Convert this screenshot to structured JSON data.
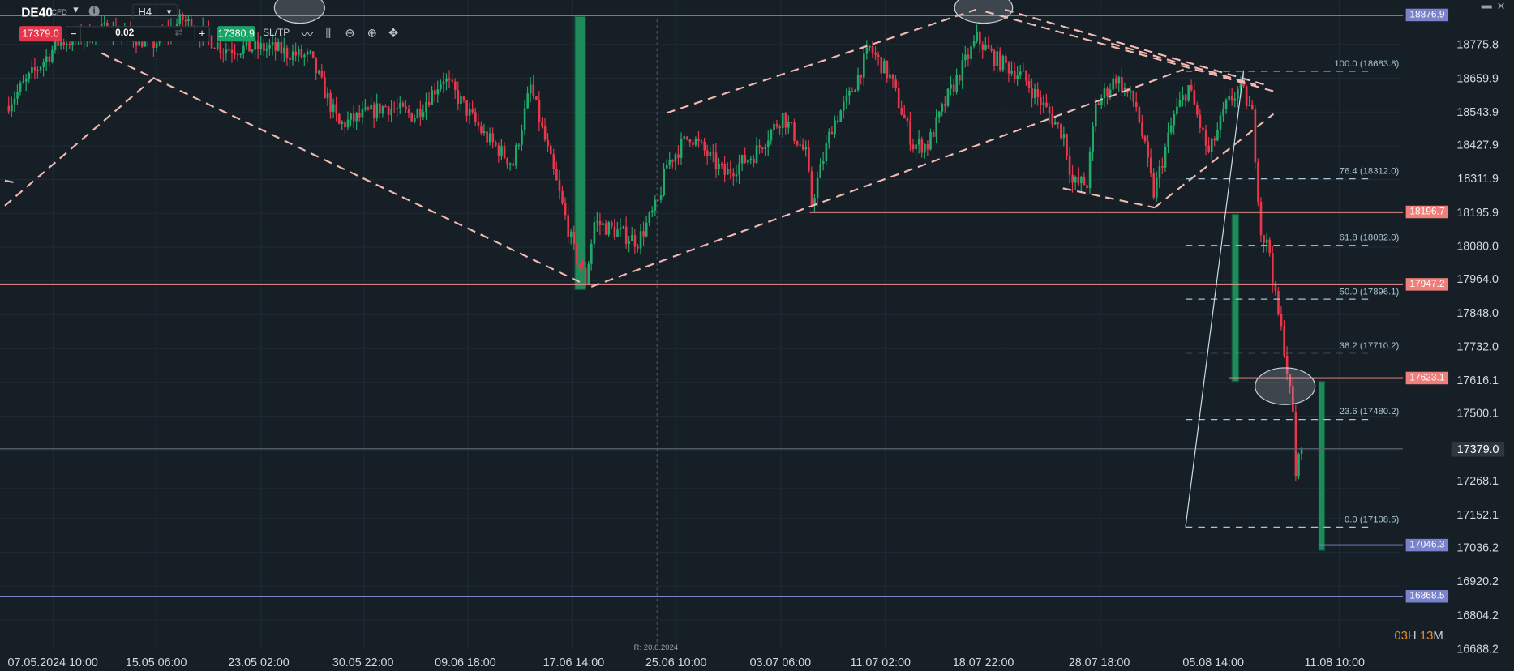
{
  "toolbar": {
    "symbol": "DE40",
    "symbol_type": "CFD",
    "timeframe": "H4",
    "sell_price": "17379.0",
    "buy_price": "17380.9",
    "volume": "0.02",
    "minus": "−",
    "plus": "+",
    "sltp": "SL/TP",
    "info": "i"
  },
  "colors": {
    "bg": "#161f26",
    "up": "#1faa6b",
    "down": "#e8364c",
    "blue_line": "#7a82cc",
    "red_line": "#f08c88",
    "trend": "#f4b8b2",
    "fib": "#a9c6d6"
  },
  "price_axis": [
    "18775.8",
    "18659.9",
    "18543.9",
    "18427.9",
    "18311.9",
    "18195.9",
    "18080.0",
    "17964.0",
    "17848.0",
    "17732.0",
    "17616.1",
    "17500.1",
    "17268.1",
    "17152.1",
    "17036.2",
    "16920.2",
    "16804.2",
    "16688.2"
  ],
  "time_axis": [
    "07.05.2024 10:00",
    "15.05 06:00",
    "23.05 02:00",
    "30.05 22:00",
    "09.06 18:00",
    "17.06 14:00",
    "25.06 10:00",
    "03.07 06:00",
    "11.07 02:00",
    "18.07 22:00",
    "28.07 18:00",
    "05.08 14:00",
    "11.08 10:00"
  ],
  "current_price": "17379.0",
  "level_tags": [
    {
      "price": 18876.9,
      "label": "18876.9",
      "kind": "blue"
    },
    {
      "price": 18196.7,
      "label": "18196.7",
      "kind": "red"
    },
    {
      "price": 17947.2,
      "label": "17947.2",
      "kind": "red"
    },
    {
      "price": 17623.1,
      "label": "17623.1",
      "kind": "red"
    },
    {
      "price": 17046.3,
      "label": "17046.3",
      "kind": "blue"
    },
    {
      "price": 16868.5,
      "label": "16868.5",
      "kind": "blue"
    }
  ],
  "fib_levels": [
    {
      "price": 18683.8,
      "label": "100.0 (18683.8)"
    },
    {
      "price": 18312.0,
      "label": "76.4 (18312.0)"
    },
    {
      "price": 18082.0,
      "label": "61.8 (18082.0)"
    },
    {
      "price": 17896.1,
      "label": "50.0 (17896.1)"
    },
    {
      "price": 17710.2,
      "label": "38.2 (17710.2)"
    },
    {
      "price": 17480.2,
      "label": "23.6 (17480.2)"
    },
    {
      "price": 17108.5,
      "label": "0.0 (17108.5)"
    }
  ],
  "price_path": [
    [
      2,
      18563
    ],
    [
      13,
      18696
    ],
    [
      20,
      18780
    ],
    [
      37,
      18830
    ],
    [
      53,
      18780
    ],
    [
      63,
      18863
    ],
    [
      77,
      18763
    ],
    [
      93,
      18763
    ],
    [
      107,
      18730
    ],
    [
      117,
      18496
    ],
    [
      133,
      18563
    ],
    [
      143,
      18530
    ],
    [
      153,
      18663
    ],
    [
      167,
      18463
    ],
    [
      177,
      18363
    ],
    [
      183,
      18630
    ],
    [
      192,
      18296
    ],
    [
      198,
      18062
    ],
    [
      202,
      17962
    ],
    [
      205,
      18162
    ],
    [
      213,
      18129
    ],
    [
      220,
      18096
    ],
    [
      227,
      18229
    ],
    [
      230,
      18363
    ],
    [
      238,
      18463
    ],
    [
      250,
      18329
    ],
    [
      260,
      18396
    ],
    [
      270,
      18530
    ],
    [
      278,
      18396
    ],
    [
      280,
      18229
    ],
    [
      287,
      18496
    ],
    [
      293,
      18596
    ],
    [
      300,
      18763
    ],
    [
      307,
      18663
    ],
    [
      315,
      18429
    ],
    [
      320,
      18429
    ],
    [
      327,
      18596
    ],
    [
      337,
      18796
    ],
    [
      343,
      18730
    ],
    [
      353,
      18663
    ],
    [
      360,
      18563
    ],
    [
      367,
      18463
    ],
    [
      370,
      18296
    ],
    [
      375,
      18296
    ],
    [
      378,
      18563
    ],
    [
      385,
      18663
    ],
    [
      392,
      18563
    ],
    [
      398,
      18262
    ],
    [
      405,
      18530
    ],
    [
      410,
      18630
    ],
    [
      417,
      18396
    ],
    [
      423,
      18563
    ],
    [
      428,
      18630
    ],
    [
      432,
      18530
    ],
    [
      435,
      18129
    ],
    [
      438,
      18062
    ],
    [
      440,
      17895
    ],
    [
      443,
      17729
    ],
    [
      446,
      17495
    ],
    [
      447,
      17295
    ],
    [
      449,
      17379
    ]
  ],
  "replay_label": "R: 20.6.2024",
  "countdown": {
    "hours": "03",
    "h": "H",
    "minutes": "13",
    "m": "M"
  },
  "window": {
    "minimize": "▬",
    "close": "✕"
  }
}
